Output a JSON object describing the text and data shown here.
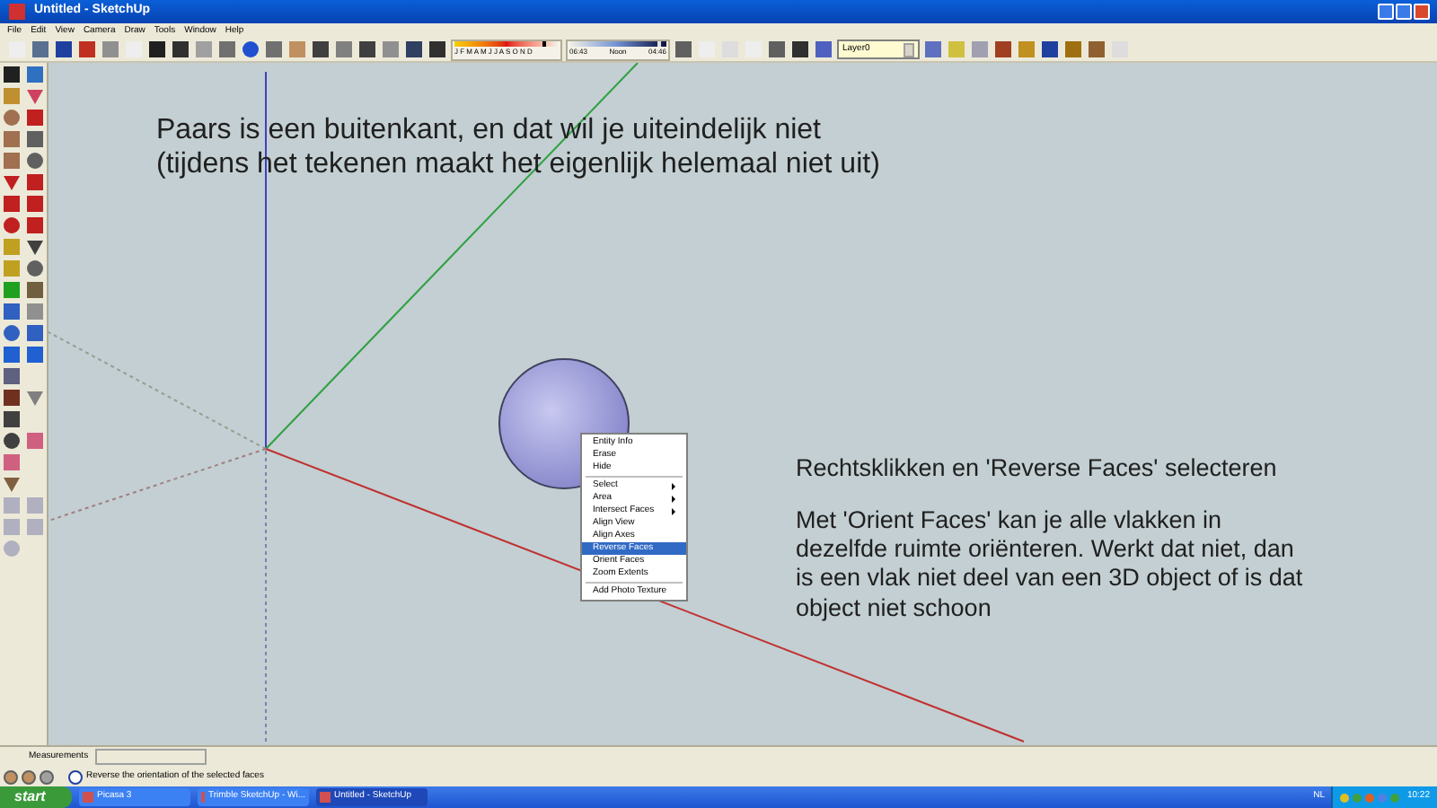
{
  "window": {
    "title": "Untitled - SketchUp"
  },
  "menu_bar": [
    "File",
    "Edit",
    "View",
    "Camera",
    "Draw",
    "Tools",
    "Window",
    "Help"
  ],
  "shadow_settings": {
    "date_slider": {
      "months": "J F M A M J J A S O N D",
      "level": 0.85
    },
    "time_slider": {
      "sunrise": "06:43",
      "noon": "Noon",
      "sunset": "04:46",
      "level": 0.9
    }
  },
  "layer_dropdown": {
    "value": "Layer0"
  },
  "canvas": {
    "notes": [
      {
        "kind": "top",
        "lines": [
          "Paars is een buitenkant, en dat wil je uiteindelijk niet",
          "(tijdens het tekenen maakt het eigenlijk helemaal niet uit)"
        ]
      },
      {
        "kind": "right",
        "lines": [
          "Rechtsklikken en 'Reverse Faces' selecteren"
        ]
      },
      {
        "kind": "right",
        "lines": [
          "Met 'Orient Faces' kan je alle vlakken in",
          "dezelfde ruimte oriënteren. Werkt dat niet, dan",
          "is een vlak niet deel van een 3D object of is dat",
          "object niet schoon"
        ]
      }
    ]
  },
  "context_menu": [
    {
      "kind": "item",
      "label": "Entity Info",
      "selected": false
    },
    {
      "kind": "item",
      "label": "Erase",
      "selected": false
    },
    {
      "kind": "item",
      "label": "Hide",
      "selected": false
    },
    {
      "kind": "separator"
    },
    {
      "kind": "submenu",
      "label": "Select",
      "selected": false
    },
    {
      "kind": "submenu",
      "label": "Area",
      "selected": false
    },
    {
      "kind": "submenu",
      "label": "Intersect Faces",
      "selected": false
    },
    {
      "kind": "item",
      "label": "Align View",
      "selected": false
    },
    {
      "kind": "item",
      "label": "Align Axes",
      "selected": false
    },
    {
      "kind": "item",
      "label": "Reverse Faces",
      "selected": true
    },
    {
      "kind": "item",
      "label": "Orient Faces",
      "selected": false
    },
    {
      "kind": "item",
      "label": "Zoom Extents",
      "selected": false
    },
    {
      "kind": "separator"
    },
    {
      "kind": "item",
      "label": "Add Photo Texture",
      "selected": false
    }
  ],
  "measurements": {
    "label": "Measurements"
  },
  "status_bar": {
    "text": "Reverse the orientation of the selected faces"
  },
  "taskbar": {
    "start": "start",
    "tasks": [
      {
        "label": "Picasa 3",
        "selected": false
      },
      {
        "label": "Trimble SketchUp - Wi...",
        "selected": false
      },
      {
        "label": "Untitled - SketchUp",
        "selected": true
      }
    ],
    "language": "NL",
    "time": "10:22"
  }
}
